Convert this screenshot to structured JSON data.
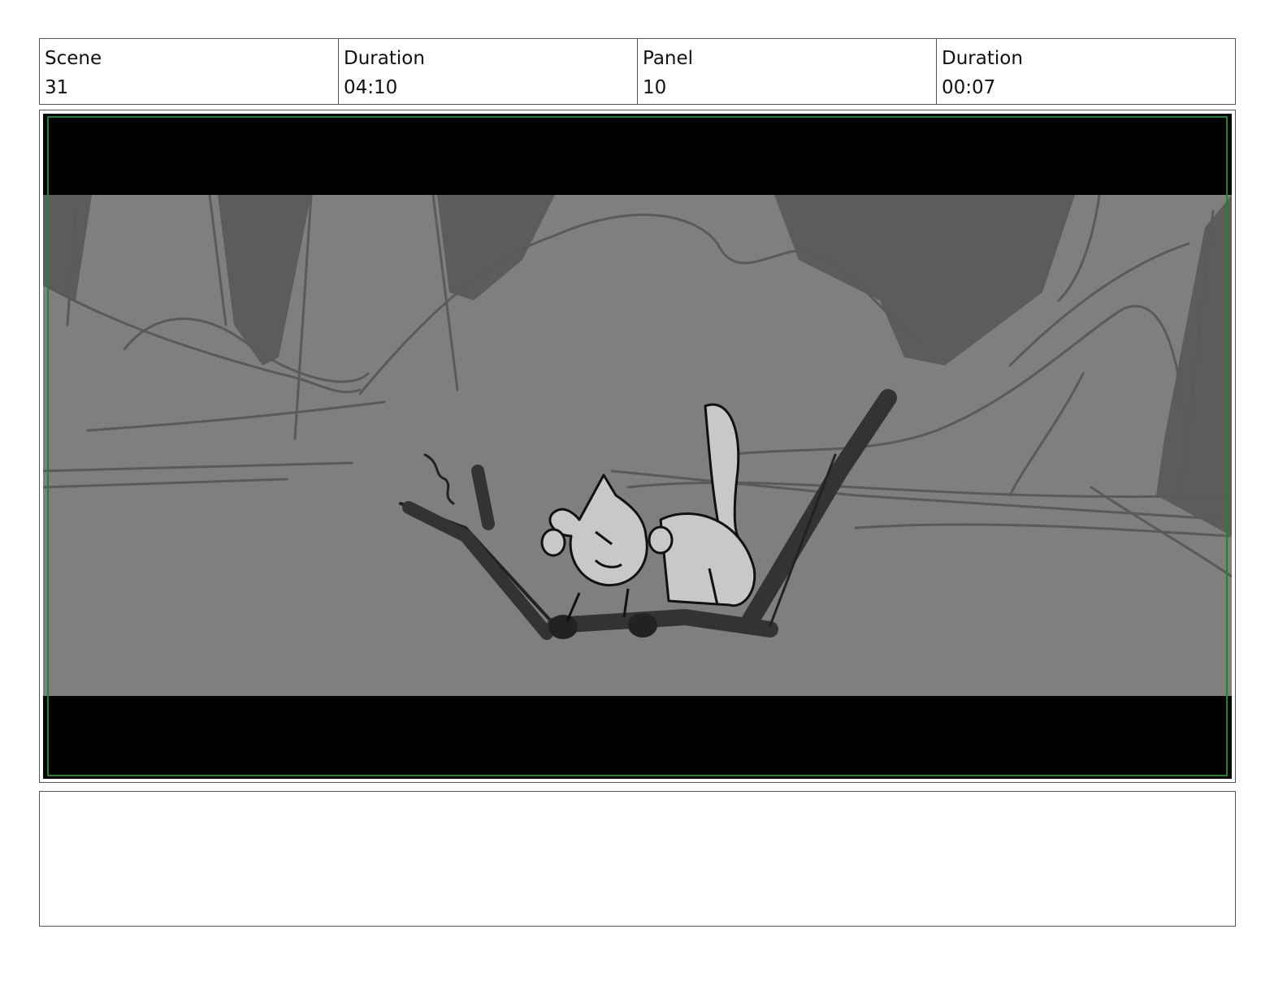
{
  "header": {
    "scene_label": "Scene",
    "scene_value": "31",
    "scene_duration_label": "Duration",
    "scene_duration_value": "04:10",
    "panel_label": "Panel",
    "panel_value": "10",
    "panel_duration_label": "Duration",
    "panel_duration_value": "00:07"
  },
  "notes": {
    "text": ""
  },
  "colors": {
    "letterbox": "#000000",
    "safe_frame": "#2e7d32",
    "background": "#7f7f7f",
    "rock_shadow": "#5c5c5c",
    "creature_fill": "#c8c8c8",
    "branch": "#333333"
  }
}
